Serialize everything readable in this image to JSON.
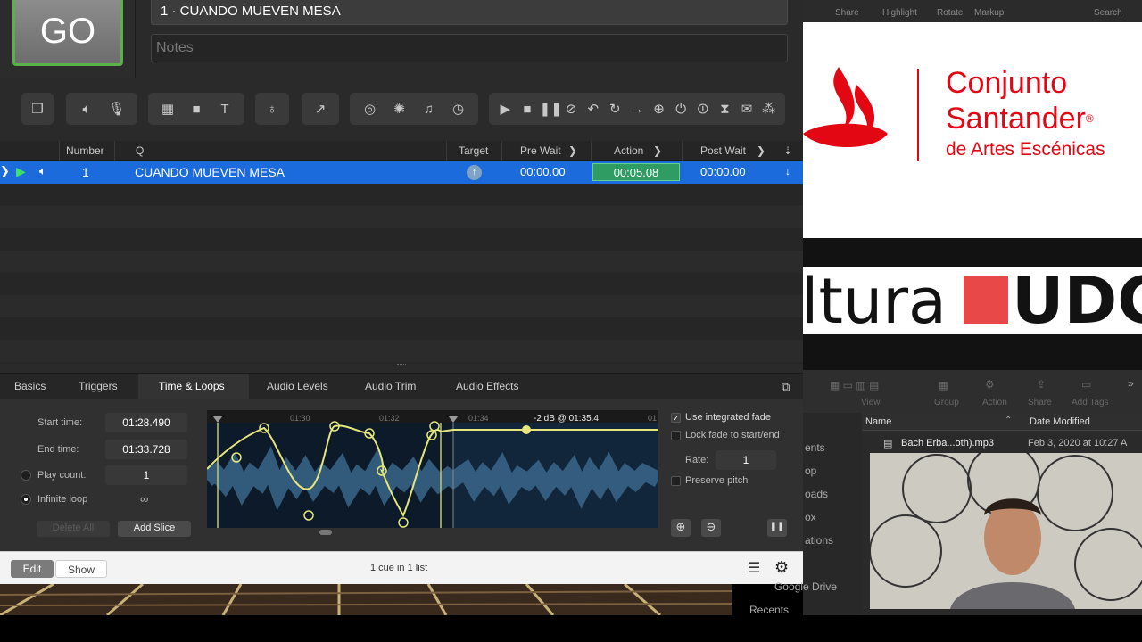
{
  "go": {
    "label": "GO"
  },
  "cue_title": "1 · CUANDO MUEVEN MESA",
  "notes_placeholder": "Notes",
  "toolbar_icons": [
    "group-icon",
    "audio-icon",
    "mic-icon",
    "video-icon",
    "camera-icon",
    "text-icon",
    "light-icon",
    "fade-icon",
    "network-icon",
    "midi-icon",
    "music-icon",
    "timecode-icon",
    "start-icon",
    "stop-icon",
    "pause-icon",
    "load-icon",
    "reset-icon",
    "devamp-icon",
    "goto-icon",
    "target-icon",
    "arm-icon",
    "disarm-icon",
    "wait-icon",
    "memo-icon",
    "script-icon"
  ],
  "cue_header": {
    "number": "Number",
    "q": "Q",
    "target": "Target",
    "pre_wait": "Pre Wait",
    "action": "Action",
    "post_wait": "Post Wait"
  },
  "cue": {
    "number": "1",
    "name": "CUANDO MUEVEN MESA",
    "pre_wait": "00:00.00",
    "action": "00:05.08",
    "post_wait": "00:00.00"
  },
  "tabs": [
    "Basics",
    "Triggers",
    "Time & Loops",
    "Audio Levels",
    "Audio Trim",
    "Audio Effects"
  ],
  "inspector": {
    "start_label": "Start time:",
    "start_value": "01:28.490",
    "end_label": "End time:",
    "end_value": "01:33.728",
    "play_count_label": "Play count:",
    "play_count_value": "1",
    "infinite_loop_label": "Infinite loop",
    "infinite_symbol": "∞",
    "delete_all": "Delete All",
    "add_slice": "Add Slice",
    "use_integrated_fade": "Use integrated fade",
    "lock_fade": "Lock fade to start/end",
    "rate_label": "Rate:",
    "rate_value": "1",
    "preserve_pitch": "Preserve pitch",
    "ruler_ticks": [
      "01:30",
      "01:32",
      "01:34",
      "01"
    ],
    "fade_readout": "-2 dB @ 01:35.4"
  },
  "bottom": {
    "edit": "Edit",
    "show": "Show",
    "status": "1 cue in 1 list"
  },
  "finder_top": [
    "Share",
    "Highlight",
    "Rotate",
    "Markup",
    "Search"
  ],
  "logo_santander": {
    "line1": "Conjunto",
    "line2": "Santander",
    "line3": "de Artes Escénicas",
    "reg": "®"
  },
  "logo_udg": {
    "left": "ltura",
    "right": "UDG"
  },
  "finder": {
    "toolbar": [
      "View",
      "Group",
      "Action",
      "Share",
      "Add Tags"
    ],
    "col_name": "Name",
    "col_date": "Date Modified",
    "file_name": "Bach Erba...oth).mp3",
    "file_date": "Feb 3, 2020 at 10:27 A",
    "sidebar": [
      "ents",
      "op",
      "oads",
      "ox",
      "ations",
      "Google Drive",
      "Recents"
    ]
  },
  "colors": {
    "accent": "#1c6bdc",
    "go_border": "#5ab14a",
    "action_cell": "#2e9c63",
    "santander_red": "#e30613",
    "fade_curve": "#e6e67a"
  }
}
